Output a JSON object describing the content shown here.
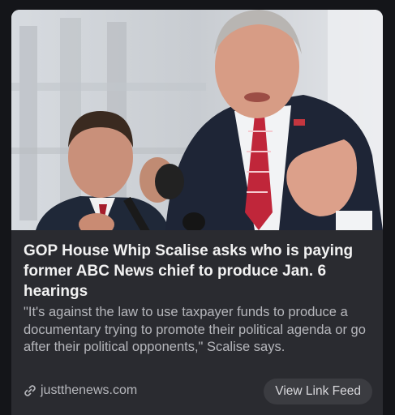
{
  "article": {
    "image_alt": "Steve Scalise speaking at a microphone outdoors",
    "headline": "GOP House Whip Scalise asks who is paying former ABC News chief to produce Jan. 6 hearings",
    "snippet": "\"It's against the law to use taxpayer funds to produce a documentary trying to promote their political agenda or go after their political opponents,\" Scalise says.",
    "source": {
      "icon": "link-icon",
      "label": "justthenews.com"
    },
    "view_feed_label": "View Link Feed"
  },
  "colors": {
    "background": "#141519",
    "card": "#2a2b30",
    "headline": "#f2f2f2",
    "snippet": "#b6b7bc",
    "button_bg": "#3b3c41"
  }
}
